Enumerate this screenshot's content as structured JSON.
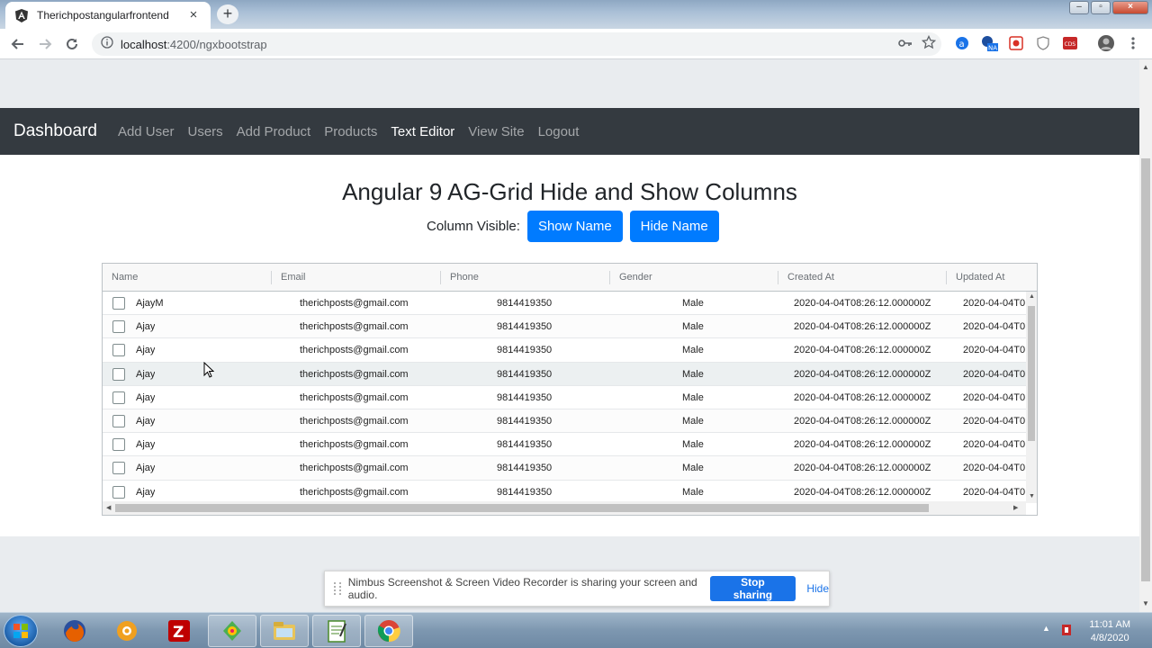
{
  "browser": {
    "tab_title": "Therichpostangularfrontend",
    "tab_close": "×",
    "new_tab": "+",
    "url_host": "localhost",
    "url_path": ":4200/ngxbootstrap"
  },
  "navbar": {
    "brand": "Dashboard",
    "links": [
      "Add User",
      "Users",
      "Add Product",
      "Products",
      "Text Editor",
      "View Site",
      "Logout"
    ],
    "active_link": "Text Editor"
  },
  "page": {
    "heading": "Angular 9 AG-Grid Hide and Show Columns",
    "visible_label": "Column Visible:",
    "show_button": "Show Name",
    "hide_button": "Hide Name"
  },
  "grid": {
    "columns": [
      "Name",
      "Email",
      "Phone",
      "Gender",
      "Created At",
      "Updated At"
    ],
    "rows": [
      [
        "AjayM",
        "therichposts@gmail.com",
        "9814419350",
        "Male",
        "2020-04-04T08:26:12.000000Z",
        "2020-04-04T0"
      ],
      [
        "Ajay",
        "therichposts@gmail.com",
        "9814419350",
        "Male",
        "2020-04-04T08:26:12.000000Z",
        "2020-04-04T0"
      ],
      [
        "Ajay",
        "therichposts@gmail.com",
        "9814419350",
        "Male",
        "2020-04-04T08:26:12.000000Z",
        "2020-04-04T0"
      ],
      [
        "Ajay",
        "therichposts@gmail.com",
        "9814419350",
        "Male",
        "2020-04-04T08:26:12.000000Z",
        "2020-04-04T0"
      ],
      [
        "Ajay",
        "therichposts@gmail.com",
        "9814419350",
        "Male",
        "2020-04-04T08:26:12.000000Z",
        "2020-04-04T0"
      ],
      [
        "Ajay",
        "therichposts@gmail.com",
        "9814419350",
        "Male",
        "2020-04-04T08:26:12.000000Z",
        "2020-04-04T0"
      ],
      [
        "Ajay",
        "therichposts@gmail.com",
        "9814419350",
        "Male",
        "2020-04-04T08:26:12.000000Z",
        "2020-04-04T0"
      ],
      [
        "Ajay",
        "therichposts@gmail.com",
        "9814419350",
        "Male",
        "2020-04-04T08:26:12.000000Z",
        "2020-04-04T0"
      ],
      [
        "Ajay",
        "therichposts@gmail.com",
        "9814419350",
        "Male",
        "2020-04-04T08:26:12.000000Z",
        "2020-04-04T0"
      ]
    ]
  },
  "sharebar": {
    "message": "Nimbus Screenshot & Screen Video Recorder is sharing your screen and audio.",
    "stop_button": "Stop sharing",
    "hide_link": "Hide"
  },
  "taskbar": {
    "time": "11:01 AM",
    "date": "4/8/2020",
    "apps": [
      "firefox-icon",
      "settings-gear-icon",
      "filezilla-icon",
      "paint-icon",
      "file-explorer-icon",
      "notepad-icon",
      "chrome-icon"
    ]
  },
  "colors": {
    "primary": "#007bff",
    "navbar_bg": "#343a40",
    "share_blue": "#1a73e8"
  }
}
